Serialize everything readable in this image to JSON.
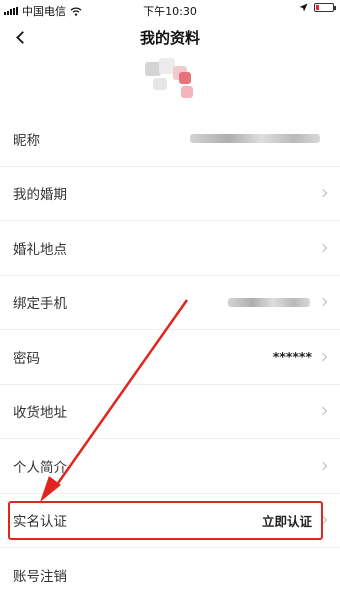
{
  "status_bar": {
    "carrier": "中国电信",
    "time": "下午10:30"
  },
  "nav": {
    "title": "我的资料"
  },
  "rows": [
    {
      "label": "昵称",
      "value": ""
    },
    {
      "label": "我的婚期",
      "value": ""
    },
    {
      "label": "婚礼地点",
      "value": ""
    },
    {
      "label": "绑定手机",
      "value": ""
    },
    {
      "label": "密码",
      "value": "******"
    },
    {
      "label": "收货地址",
      "value": ""
    },
    {
      "label": "个人简介",
      "value": ""
    },
    {
      "label": "实名认证",
      "value": "立即认证"
    },
    {
      "label": "账号注销",
      "value": ""
    }
  ],
  "colors": {
    "annotation": "#e0261e",
    "divider": "#eeeeee"
  },
  "icons": [
    "wifi-icon",
    "location-icon",
    "battery-icon",
    "back-chevron-icon",
    "chevron-right-icon",
    "annotation-arrow"
  ]
}
